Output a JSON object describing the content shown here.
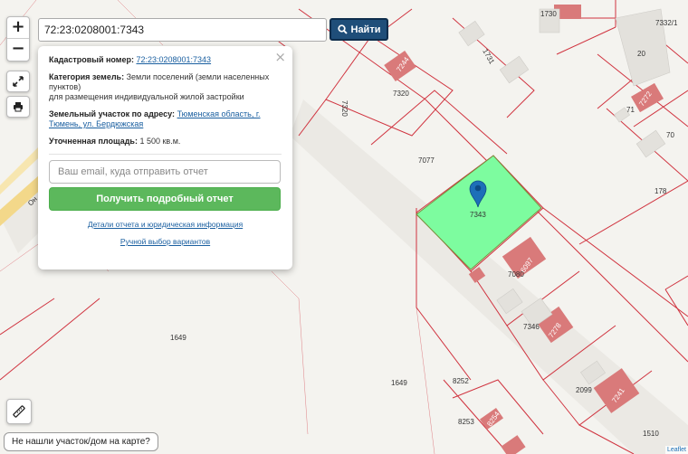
{
  "search": {
    "value": "72:23:0208001:7343",
    "button_label": "Найти"
  },
  "popup": {
    "cadastral_label": "Кадастровый номер:",
    "cadastral_value": "72:23:0208001:7343",
    "category_label": "Категория земель:",
    "category_value": "Земли поселений (земли населенных пунктов)",
    "usage": "для размещения индивидуальной жилой застройки",
    "address_label": "Земельный участок по адресу:",
    "address_value": "Тюменская область, г. Тюмень, ул. Бердюжская",
    "area_label": "Уточненная площадь:",
    "area_value": "1 500 кв.м.",
    "email_placeholder": "Ваш email, куда отправить отчет",
    "report_button": "Получить подробный отчет",
    "details_link": "Детали отчета и юридическая информация",
    "manual_link": "Ручной выбор вариантов"
  },
  "controls": {
    "zoom_in": "+",
    "zoom_out": "−"
  },
  "not_found_button": "Не нашли участок/дом на карте?",
  "attribution": "Leaflet",
  "map_labels": {
    "road": "Он",
    "p1730": "1730",
    "p7332": "7332/1",
    "p20": "20",
    "p7320a": "7320",
    "p7320b": "7320",
    "p1731": "1731",
    "p7244": "7244",
    "p71": "71",
    "p7272": "7272",
    "p70": "70",
    "p7077": "7077",
    "p7343": "7343",
    "p178": "178",
    "p7080": "7080",
    "p6097": "6097",
    "p7346": "7346",
    "p7278": "7278",
    "p1649a": "1649",
    "p1649b": "1649",
    "p8252a": "8252",
    "p8252b": "8253",
    "p8254": "8254",
    "p2099": "2099",
    "p7241": "7241",
    "p1510": "1510"
  },
  "colors": {
    "selected_parcel": "#7dfc9f",
    "parcel_border": "#d0333f",
    "building": "#d97a7a",
    "search_button": "#1f4e79",
    "report_button": "#5cb85c",
    "marker": "#1d6fb8"
  }
}
